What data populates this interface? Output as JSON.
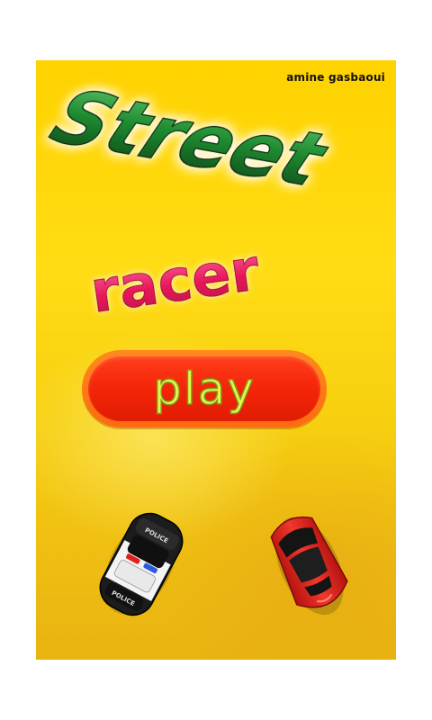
{
  "screen": "main-menu",
  "author": "amine gasbaoui",
  "title": {
    "line1": "Street",
    "line2": "racer"
  },
  "play_button": {
    "label": "play"
  },
  "cars": {
    "police": {
      "roof_text": "POLICE",
      "hood_text": "POLICE"
    },
    "player_color": "#e8201a"
  },
  "colors": {
    "background": "#ffd700",
    "title_line1": "#1f7a2c",
    "title_line2": "#e8185a",
    "play_button_fill": "#f42508",
    "play_button_rim": "#ff7a18",
    "play_label": "#e7f548"
  }
}
